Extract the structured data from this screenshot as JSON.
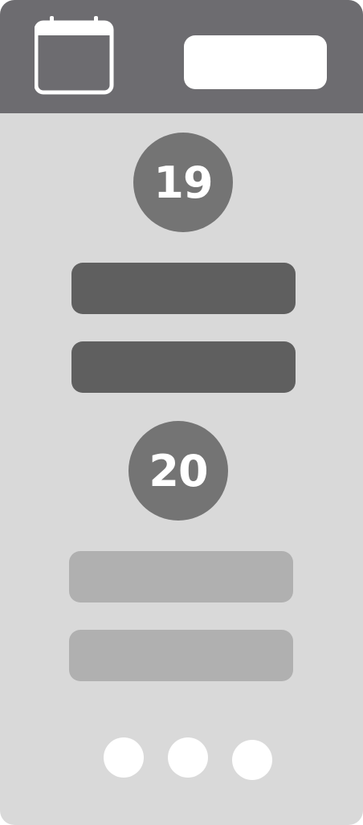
{
  "header": {
    "icon": "calendar-icon"
  },
  "days": [
    {
      "day_number": "19"
    },
    {
      "day_number": "20"
    }
  ],
  "pagination": {
    "dot_count": 3
  },
  "colors": {
    "header_bg": "#6d6c70",
    "content_bg": "#d9d9d9",
    "badge_bg": "#747474",
    "event_dark": "#5f5f5f",
    "event_light": "#b0b0b0"
  }
}
